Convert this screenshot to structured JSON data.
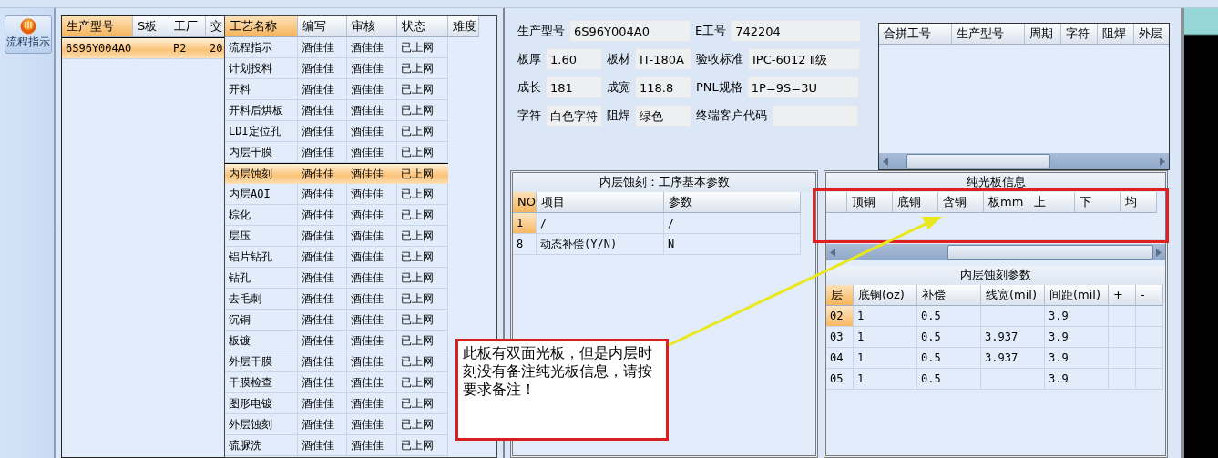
{
  "sidebar": {
    "buttons": [
      {
        "label": "流程指示",
        "selected": true
      }
    ]
  },
  "jobs": {
    "columns": [
      "生产型号",
      "S板",
      "工厂",
      "交"
    ],
    "rows": [
      {
        "cells": [
          "6S96Y004A0",
          null,
          "P2",
          "20"
        ],
        "selected": true
      }
    ]
  },
  "processes": {
    "columns": [
      "工艺名称",
      "编写",
      "审核",
      "状态",
      "难度"
    ],
    "rows": [
      {
        "cells": [
          "流程指示",
          "酒佳佳",
          "酒佳佳",
          "已上网"
        ],
        "selected": false
      },
      {
        "cells": [
          "计划投料",
          "酒佳佳",
          "酒佳佳",
          "已上网"
        ],
        "selected": false
      },
      {
        "cells": [
          "开料",
          "酒佳佳",
          "酒佳佳",
          "已上网"
        ],
        "selected": false
      },
      {
        "cells": [
          "开料后烘板",
          "酒佳佳",
          "酒佳佳",
          "已上网"
        ],
        "selected": false
      },
      {
        "cells": [
          "LDI定位孔",
          "酒佳佳",
          "酒佳佳",
          "已上网"
        ],
        "selected": false
      },
      {
        "cells": [
          "内层干膜",
          "酒佳佳",
          "酒佳佳",
          "已上网"
        ],
        "selected": false
      },
      {
        "cells": [
          "内层蚀刻",
          "酒佳佳",
          "酒佳佳",
          "已上网"
        ],
        "selected": true
      },
      {
        "cells": [
          "内层AOI",
          "酒佳佳",
          "酒佳佳",
          "已上网"
        ],
        "selected": false
      },
      {
        "cells": [
          "棕化",
          "酒佳佳",
          "酒佳佳",
          "已上网"
        ],
        "selected": false
      },
      {
        "cells": [
          "层压",
          "酒佳佳",
          "酒佳佳",
          "已上网"
        ],
        "selected": false
      },
      {
        "cells": [
          "铝片钻孔",
          "酒佳佳",
          "酒佳佳",
          "已上网"
        ],
        "selected": false
      },
      {
        "cells": [
          "钻孔",
          "酒佳佳",
          "酒佳佳",
          "已上网"
        ],
        "selected": false
      },
      {
        "cells": [
          "去毛刺",
          "酒佳佳",
          "酒佳佳",
          "已上网"
        ],
        "selected": false
      },
      {
        "cells": [
          "沉铜",
          "酒佳佳",
          "酒佳佳",
          "已上网"
        ],
        "selected": false
      },
      {
        "cells": [
          "板镀",
          "酒佳佳",
          "酒佳佳",
          "已上网"
        ],
        "selected": false
      },
      {
        "cells": [
          "外层干膜",
          "酒佳佳",
          "酒佳佳",
          "已上网"
        ],
        "selected": false
      },
      {
        "cells": [
          "干膜检查",
          "酒佳佳",
          "酒佳佳",
          "已上网"
        ],
        "selected": false
      },
      {
        "cells": [
          "图形电镀",
          "酒佳佳",
          "酒佳佳",
          "已上网"
        ],
        "selected": false
      },
      {
        "cells": [
          "外层蚀刻",
          "酒佳佳",
          "酒佳佳",
          "已上网"
        ],
        "selected": false
      },
      {
        "cells": [
          "硫脲洗",
          "酒佳佳",
          "酒佳佳",
          "已上网"
        ],
        "selected": false
      }
    ]
  },
  "info_form": {
    "fields": [
      {
        "label": "生产型号",
        "value": "6S96Y004A0"
      },
      {
        "label": "E工号",
        "value": "742204"
      },
      {
        "label": "板厚",
        "value": "1.60"
      },
      {
        "label": "板材",
        "value": "IT-180A"
      },
      {
        "label": "验收标准",
        "value": "IPC-6012 Ⅱ级"
      },
      {
        "label": "成长",
        "value": "181"
      },
      {
        "label": "成宽",
        "value": "118.8"
      },
      {
        "label": "PNL规格",
        "value": "1P=9S=3U"
      },
      {
        "label": "字符",
        "value": "白色字符"
      },
      {
        "label": "阻焊",
        "value": "绿色"
      },
      {
        "label": "终端客户代码"
      }
    ]
  },
  "merged_jobs": {
    "columns": [
      "合拼工号",
      "生产型号",
      "周期",
      "字符",
      "阻焊",
      "外层"
    ]
  },
  "basic_params": {
    "title": "内层蚀刻：工序基本参数",
    "columns": [
      "NO",
      "项目",
      "参数"
    ],
    "rows": [
      {
        "cells": [
          "1",
          "/",
          "/"
        ],
        "selected": true
      },
      {
        "cells": [
          "8",
          "动态补偿(Y/N)",
          "N"
        ],
        "selected": false
      }
    ]
  },
  "bare_board": {
    "title": "纯光板信息",
    "columns": [
      "顶铜",
      "底铜",
      "含铜",
      "板mm",
      "上",
      "下",
      "均"
    ]
  },
  "etch_params": {
    "title": "内层蚀刻参数",
    "columns": [
      "层",
      "底铜(oz)",
      "补偿",
      "线宽(mil)",
      "间距(mil)",
      "+",
      "-"
    ],
    "rows": [
      {
        "cells": [
          "02",
          "1",
          "0.5",
          null,
          "3.9"
        ],
        "selected": true
      },
      {
        "cells": [
          "03",
          "1",
          "0.5",
          "3.937",
          "3.9"
        ],
        "selected": false
      },
      {
        "cells": [
          "04",
          "1",
          "0.5",
          "3.937",
          "3.9"
        ],
        "selected": false
      },
      {
        "cells": [
          "05",
          "1",
          "0.5",
          null,
          "3.9"
        ],
        "selected": false
      }
    ]
  },
  "note": {
    "text": "此板有双面光板，但是内层时刻没有备注纯光板信息，请按要求备注！"
  }
}
